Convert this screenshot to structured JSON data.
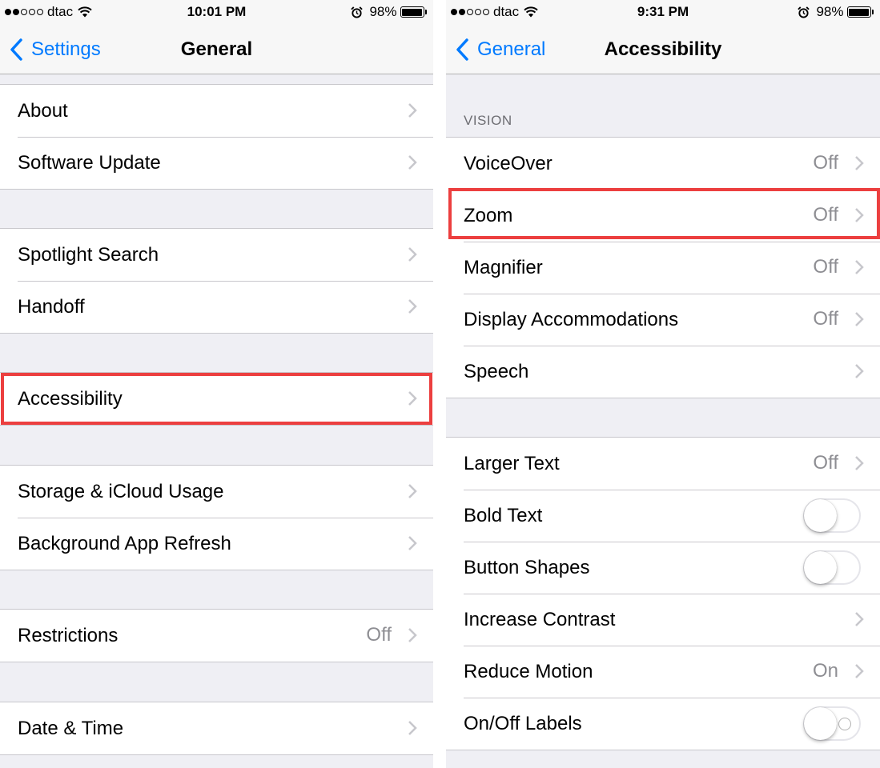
{
  "colors": {
    "accent": "#007aff",
    "highlight": "#ec3f3f",
    "secondary_text": "#8e8e93"
  },
  "left": {
    "status": {
      "carrier": "dtac",
      "time": "10:01 PM",
      "battery": "98%",
      "battery_level": 0.98
    },
    "nav": {
      "back_label": "Settings",
      "title": "General"
    },
    "groups": [
      {
        "items": [
          {
            "label": "About"
          },
          {
            "label": "Software Update"
          }
        ]
      },
      {
        "items": [
          {
            "label": "Spotlight Search"
          },
          {
            "label": "Handoff"
          }
        ]
      },
      {
        "items": [
          {
            "label": "Accessibility",
            "highlighted": true
          }
        ]
      },
      {
        "items": [
          {
            "label": "Storage & iCloud Usage"
          },
          {
            "label": "Background App Refresh"
          }
        ]
      },
      {
        "items": [
          {
            "label": "Restrictions",
            "value": "Off"
          }
        ]
      },
      {
        "items": [
          {
            "label": "Date & Time"
          }
        ]
      }
    ]
  },
  "right": {
    "status": {
      "carrier": "dtac",
      "time": "9:31 PM",
      "battery": "98%",
      "battery_level": 0.98
    },
    "nav": {
      "back_label": "General",
      "title": "Accessibility"
    },
    "section_header": "VISION",
    "groups": [
      {
        "items": [
          {
            "label": "VoiceOver",
            "value": "Off"
          },
          {
            "label": "Zoom",
            "value": "Off",
            "highlighted": true
          },
          {
            "label": "Magnifier",
            "value": "Off"
          },
          {
            "label": "Display Accommodations",
            "value": "Off"
          },
          {
            "label": "Speech"
          }
        ]
      },
      {
        "items": [
          {
            "label": "Larger Text",
            "value": "Off"
          },
          {
            "label": "Bold Text",
            "toggle": false
          },
          {
            "label": "Button Shapes",
            "toggle": false
          },
          {
            "label": "Increase Contrast"
          },
          {
            "label": "Reduce Motion",
            "value": "On"
          },
          {
            "label": "On/Off Labels",
            "toggle": false,
            "onoff_labels": true
          }
        ]
      }
    ]
  }
}
